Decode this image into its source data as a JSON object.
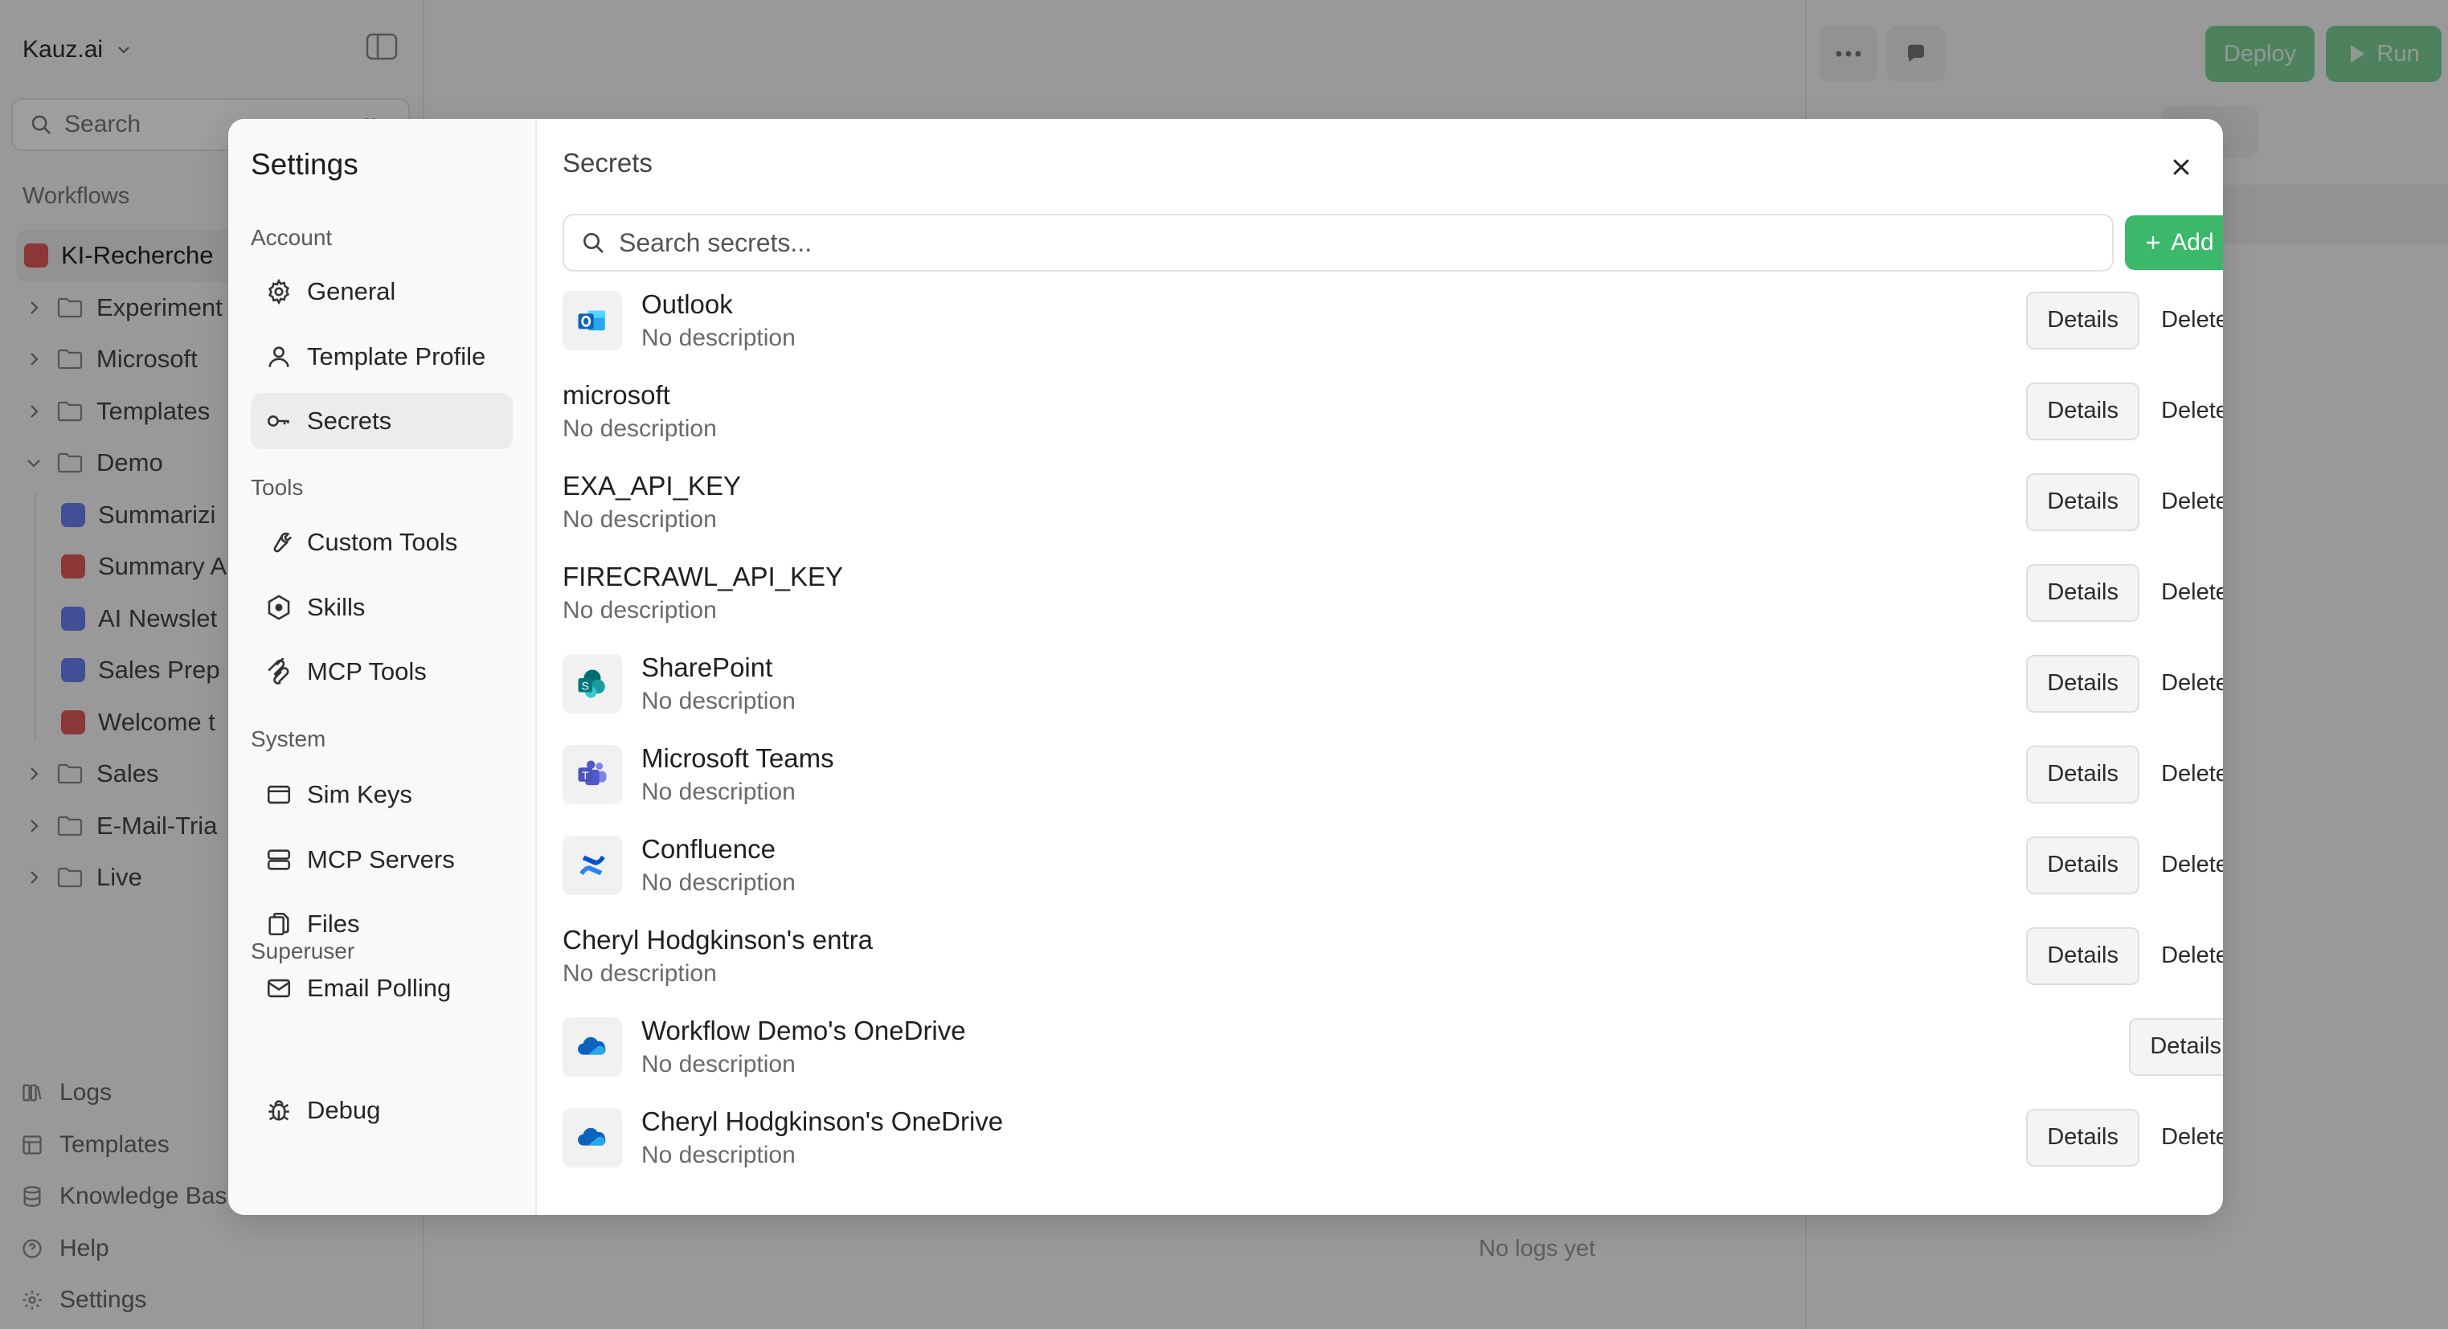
{
  "workspace": {
    "name": "Kauz.ai"
  },
  "app_sidebar": {
    "search_placeholder": "Search",
    "search_shortcut": "⌘K",
    "workflows_label": "Workflows",
    "items": [
      {
        "label": "KI-Recherche",
        "kind": "workflow",
        "color": "#e05a5a",
        "indent": 0,
        "active": true
      },
      {
        "label": "Experiment",
        "kind": "folder",
        "indent": 0
      },
      {
        "label": "Microsoft",
        "kind": "folder",
        "indent": 0
      },
      {
        "label": "Templates",
        "kind": "folder",
        "indent": 0
      },
      {
        "label": "Demo",
        "kind": "folder-open",
        "indent": 0
      },
      {
        "label": "Summarizi",
        "kind": "workflow",
        "color": "#6b7ff0",
        "indent": 1
      },
      {
        "label": "Summary A",
        "kind": "workflow",
        "color": "#e05a5a",
        "indent": 1
      },
      {
        "label": "AI Newslet",
        "kind": "workflow",
        "color": "#6b7ff0",
        "indent": 1
      },
      {
        "label": "Sales Prep",
        "kind": "workflow",
        "color": "#6b7ff0",
        "indent": 1
      },
      {
        "label": "Welcome t",
        "kind": "workflow",
        "color": "#e05a5a",
        "indent": 1
      },
      {
        "label": "Sales",
        "kind": "folder",
        "indent": 0
      },
      {
        "label": "E-Mail-Tria",
        "kind": "folder",
        "indent": 0
      },
      {
        "label": "Live",
        "kind": "folder",
        "indent": 0
      }
    ],
    "bottom": [
      "Logs",
      "Templates",
      "Knowledge Base",
      "Help",
      "Settings"
    ]
  },
  "canvas": {
    "empty_logs": "No logs yet"
  },
  "toolbar": {
    "deploy_label": "Deploy",
    "run_label": "Run"
  },
  "settings": {
    "title": "Settings",
    "sections": [
      {
        "label": "Account",
        "items": [
          {
            "label": "General",
            "icon": "gear-icon"
          },
          {
            "label": "Template Profile",
            "icon": "user-icon"
          },
          {
            "label": "Secrets",
            "icon": "key-icon",
            "active": true
          }
        ]
      },
      {
        "label": "Tools",
        "items": [
          {
            "label": "Custom Tools",
            "icon": "wrench-icon"
          },
          {
            "label": "Skills",
            "icon": "hexagon-icon"
          },
          {
            "label": "MCP Tools",
            "icon": "mcp-icon"
          }
        ]
      },
      {
        "label": "System",
        "items": [
          {
            "label": "Sim Keys",
            "icon": "card-icon"
          },
          {
            "label": "MCP Servers",
            "icon": "server-icon"
          },
          {
            "label": "Files",
            "icon": "files-icon"
          },
          {
            "label": "Email Polling",
            "icon": "mail-icon"
          }
        ]
      },
      {
        "label": "Superuser",
        "items": [
          {
            "label": "Debug",
            "icon": "bug-icon"
          }
        ]
      }
    ]
  },
  "secrets": {
    "title": "Secrets",
    "search_placeholder": "Search secrets...",
    "add_label": "Add",
    "details_label": "Details",
    "delete_label": "Delete",
    "items": [
      {
        "name": "Outlook",
        "description": "No description",
        "icon": "outlook-icon",
        "deletable": true
      },
      {
        "name": "microsoft",
        "description": "No description",
        "icon": null,
        "deletable": true
      },
      {
        "name": "EXA_API_KEY",
        "description": "No description",
        "icon": null,
        "deletable": true
      },
      {
        "name": "FIRECRAWL_API_KEY",
        "description": "No description",
        "icon": null,
        "deletable": true
      },
      {
        "name": "SharePoint",
        "description": "No description",
        "icon": "sharepoint-icon",
        "deletable": true
      },
      {
        "name": "Microsoft Teams",
        "description": "No description",
        "icon": "teams-icon",
        "deletable": true
      },
      {
        "name": "Confluence",
        "description": "No description",
        "icon": "confluence-icon",
        "deletable": true
      },
      {
        "name": "Cheryl Hodgkinson's entra",
        "description": "No description",
        "icon": null,
        "deletable": true
      },
      {
        "name": "Workflow Demo's OneDrive",
        "description": "No description",
        "icon": "onedrive-icon",
        "deletable": false
      },
      {
        "name": "Cheryl Hodgkinson's OneDrive",
        "description": "No description",
        "icon": "onedrive-icon",
        "deletable": true
      }
    ]
  }
}
